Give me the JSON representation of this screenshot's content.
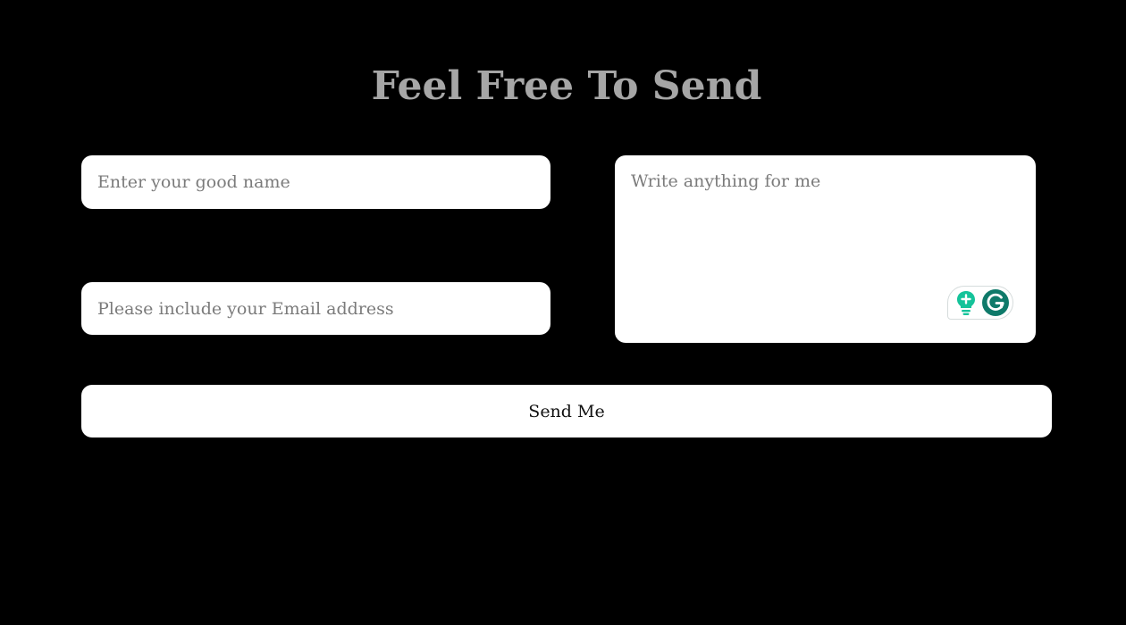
{
  "page": {
    "title": "Feel Free To Send"
  },
  "form": {
    "name_placeholder": "Enter your good name",
    "name_value": "",
    "email_placeholder": "Please include your Email address",
    "email_value": "",
    "message_placeholder": "Write anything for me",
    "message_value": "",
    "submit_label": "Send Me"
  },
  "assist_widget": {
    "icons": [
      "lightbulb-icon",
      "grammarly-icon"
    ]
  },
  "colors": {
    "background": "#000000",
    "title": "#a6a6a6",
    "field_background": "#ffffff",
    "placeholder": "#7b7b7b",
    "lightbulb": "#15c39a",
    "grammarly": "#0f7a6a"
  }
}
